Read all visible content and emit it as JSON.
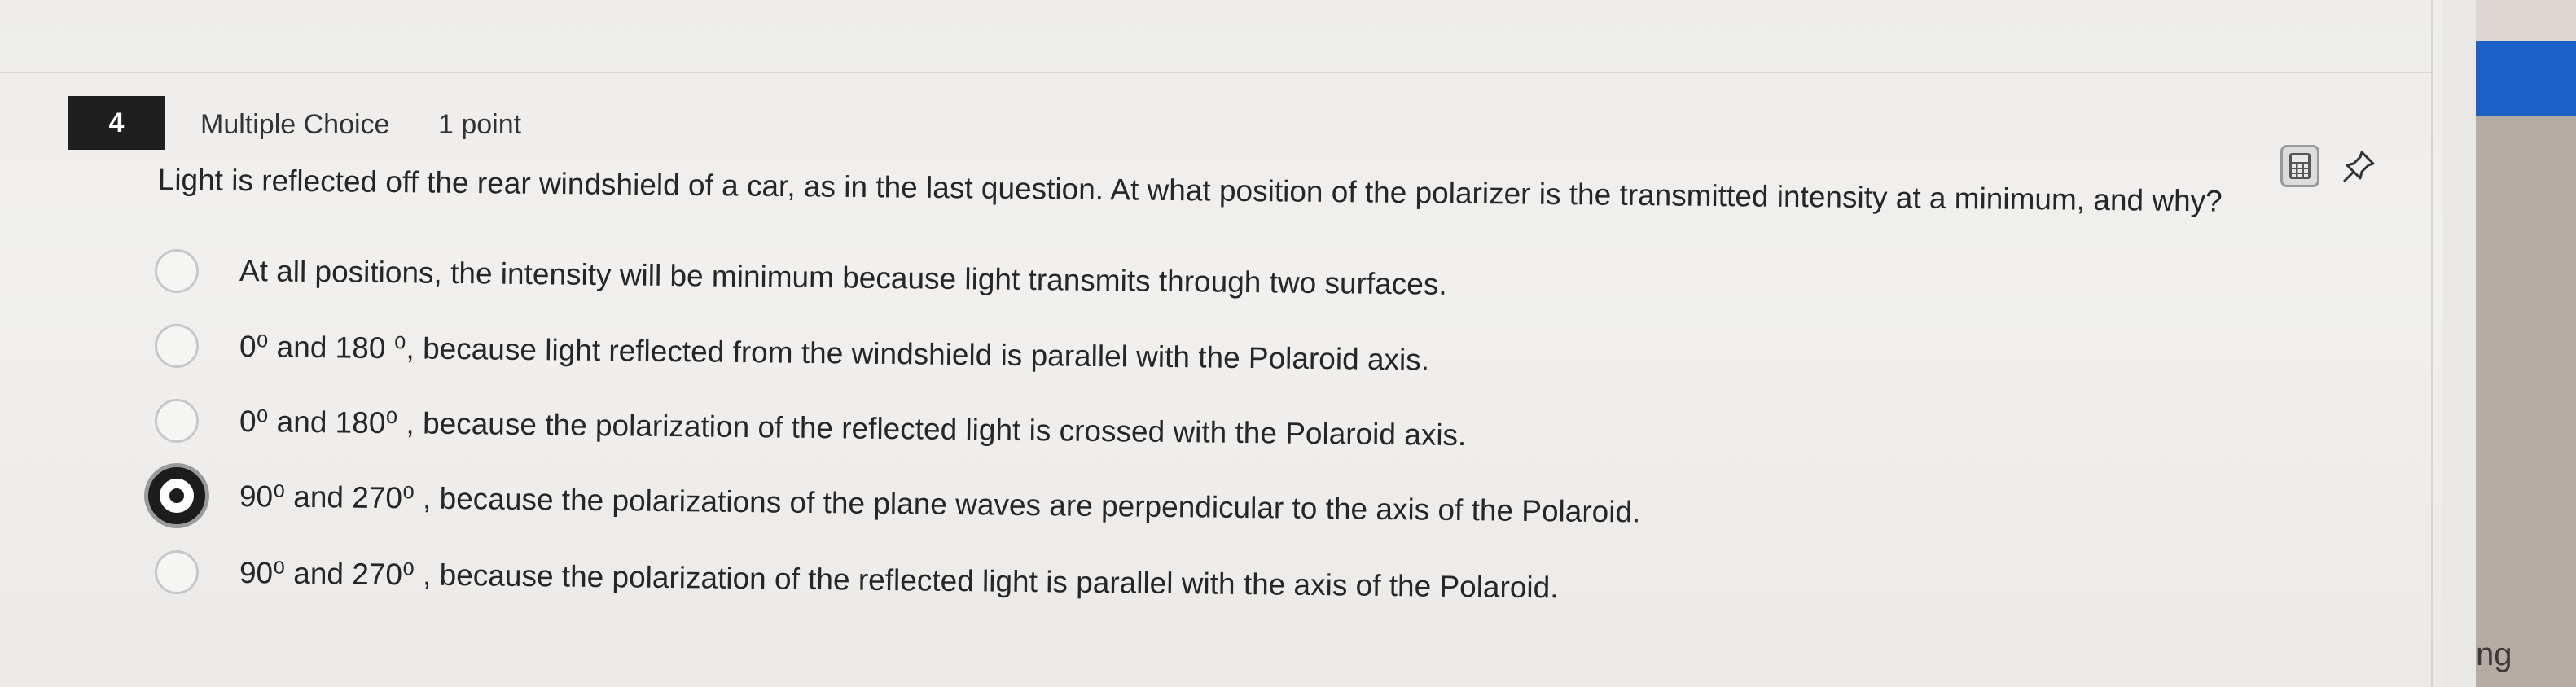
{
  "question": {
    "number": "4",
    "type": "Multiple Choice",
    "points": "1 point",
    "prompt": "Light is reflected off the rear windshield of a car, as in the last question. At what position of the polarizer is the transmitted intensity at a minimum, and why?"
  },
  "options": [
    {
      "text": "At all positions, the intensity will be minimum because light transmits through two surfaces.",
      "selected": false
    },
    {
      "text": "0⁰ and 180 ⁰, because light reflected from the windshield is parallel with the Polaroid axis.",
      "selected": false
    },
    {
      "text": "0⁰ and 180⁰ , because the polarization of the reflected light is crossed with the Polaroid axis.",
      "selected": false
    },
    {
      "text": "90⁰ and 270⁰ , because the polarizations of the plane waves are perpendicular to the axis of the Polaroid.",
      "selected": true
    },
    {
      "text": "90⁰ and 270⁰ , because the polarization of the reflected light is parallel with the axis of the Polaroid.",
      "selected": false
    }
  ],
  "tools": {
    "calculator_icon": "calculator-icon",
    "pin_icon": "pin-icon"
  },
  "side_panel": {
    "partial_text": "ng"
  },
  "colors": {
    "question_badge": "#1f1f1f",
    "side_panel_accent": "#1b62c8"
  }
}
